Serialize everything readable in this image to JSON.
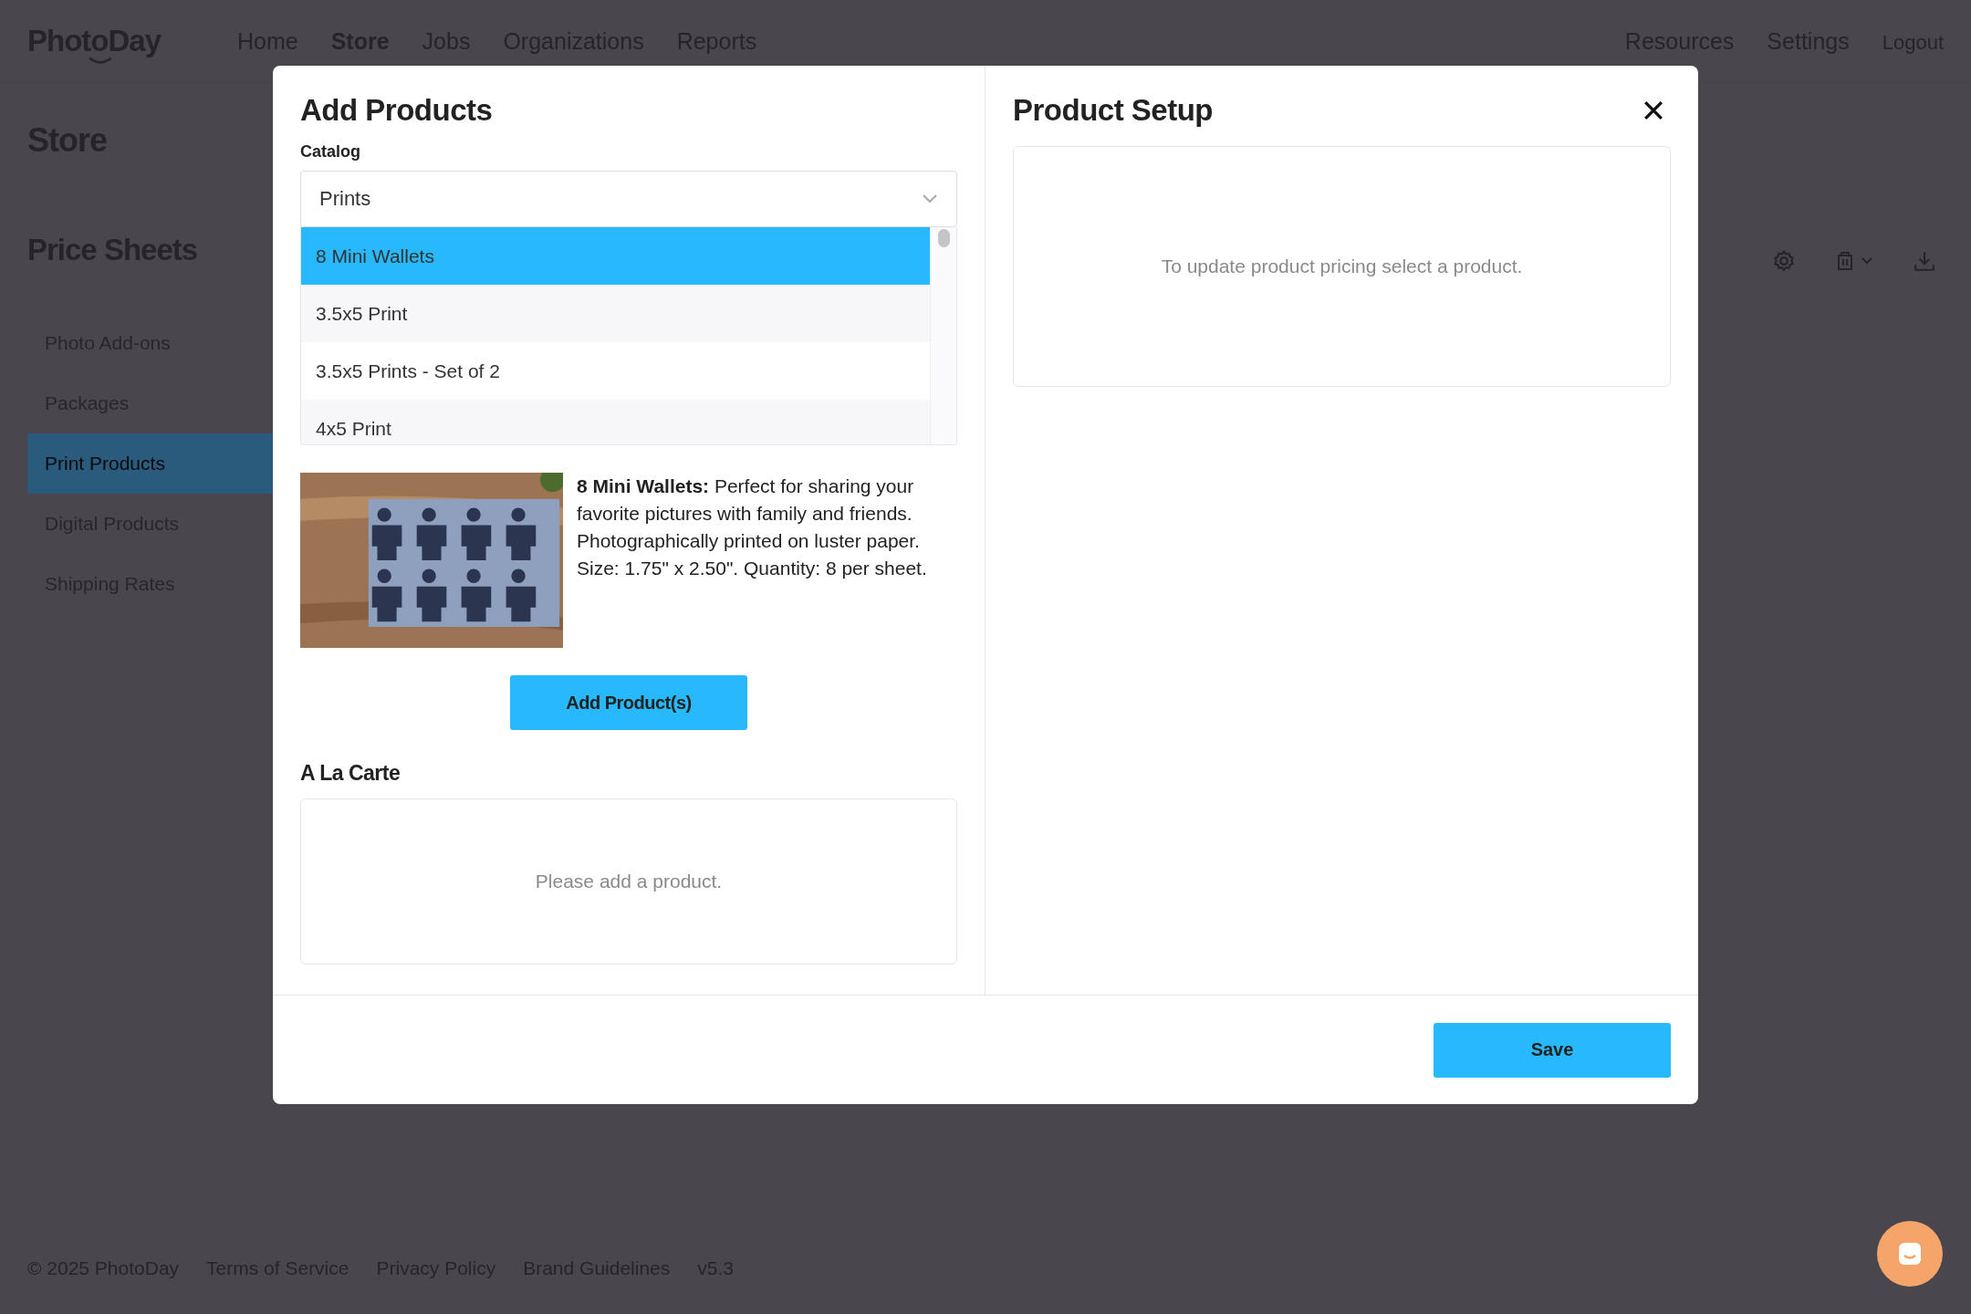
{
  "header": {
    "logo": "PhotoDay",
    "nav": [
      {
        "label": "Home",
        "selected": false
      },
      {
        "label": "Store",
        "selected": true
      },
      {
        "label": "Jobs",
        "selected": false
      },
      {
        "label": "Organizations",
        "selected": false
      },
      {
        "label": "Reports",
        "selected": false
      }
    ],
    "right_nav": [
      "Resources",
      "Settings",
      "Logout"
    ]
  },
  "page": {
    "title": "Store",
    "section_title": "Price Sheets",
    "sidebar": {
      "items": [
        {
          "label": "Photo Add-ons",
          "selected": false
        },
        {
          "label": "Packages",
          "selected": false
        },
        {
          "label": "Print Products",
          "selected": true
        },
        {
          "label": "Digital Products",
          "selected": false
        },
        {
          "label": "Shipping Rates",
          "selected": false
        }
      ]
    }
  },
  "footer": {
    "links": [
      "© 2025 PhotoDay",
      "Terms of Service",
      "Privacy Policy",
      "Brand Guidelines",
      "v5.3"
    ]
  },
  "modal": {
    "add_products": {
      "title": "Add Products",
      "catalog_label": "Catalog",
      "catalog_value": "Prints",
      "options": [
        {
          "label": "8 Mini Wallets",
          "selected": true
        },
        {
          "label": "3.5x5 Print",
          "selected": false
        },
        {
          "label": "3.5x5 Prints - Set of 2",
          "selected": false
        },
        {
          "label": "4x5 Print",
          "selected": false
        }
      ],
      "description": "**8 Mini Wallets:** Perfect for sharing your favorite pictures with family and friends. Photographically printed on luster paper. Size: 1.75\" x 2.50\". Quantity: 8 per sheet.",
      "add_button": "Add Product(s)",
      "a_la_carte_title": "A La Carte",
      "a_la_carte_empty": "Please add a product."
    },
    "product_setup": {
      "title": "Product Setup",
      "empty_message": "To update product pricing select a product."
    },
    "save_button": "Save"
  }
}
